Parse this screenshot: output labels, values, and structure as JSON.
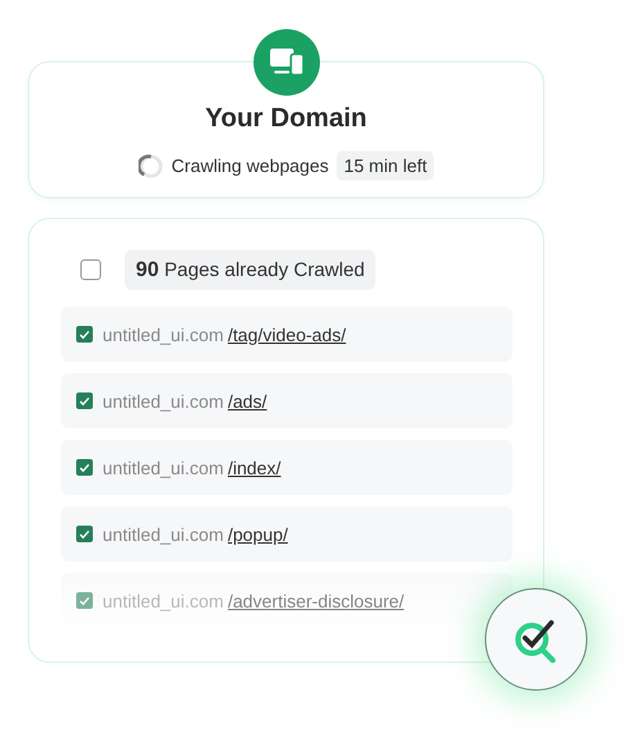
{
  "domain_card": {
    "title": "Your Domain",
    "status": "Crawling webpages",
    "time_left": "15 min left"
  },
  "pages_card": {
    "header": {
      "checked": false,
      "count": "90",
      "label": "Pages already Crawled"
    },
    "rows": [
      {
        "domain": "untitled_ui.com",
        "path": "/tag/video-ads/",
        "checked": true,
        "faded": false
      },
      {
        "domain": "untitled_ui.com",
        "path": "/ads/",
        "checked": true,
        "faded": false
      },
      {
        "domain": "untitled_ui.com",
        "path": "/index/",
        "checked": true,
        "faded": false
      },
      {
        "domain": "untitled_ui.com",
        "path": "/popup/",
        "checked": true,
        "faded": false
      },
      {
        "domain": "untitled_ui.com",
        "path": "/advertiser-disclosure/",
        "checked": true,
        "faded": true
      }
    ]
  }
}
